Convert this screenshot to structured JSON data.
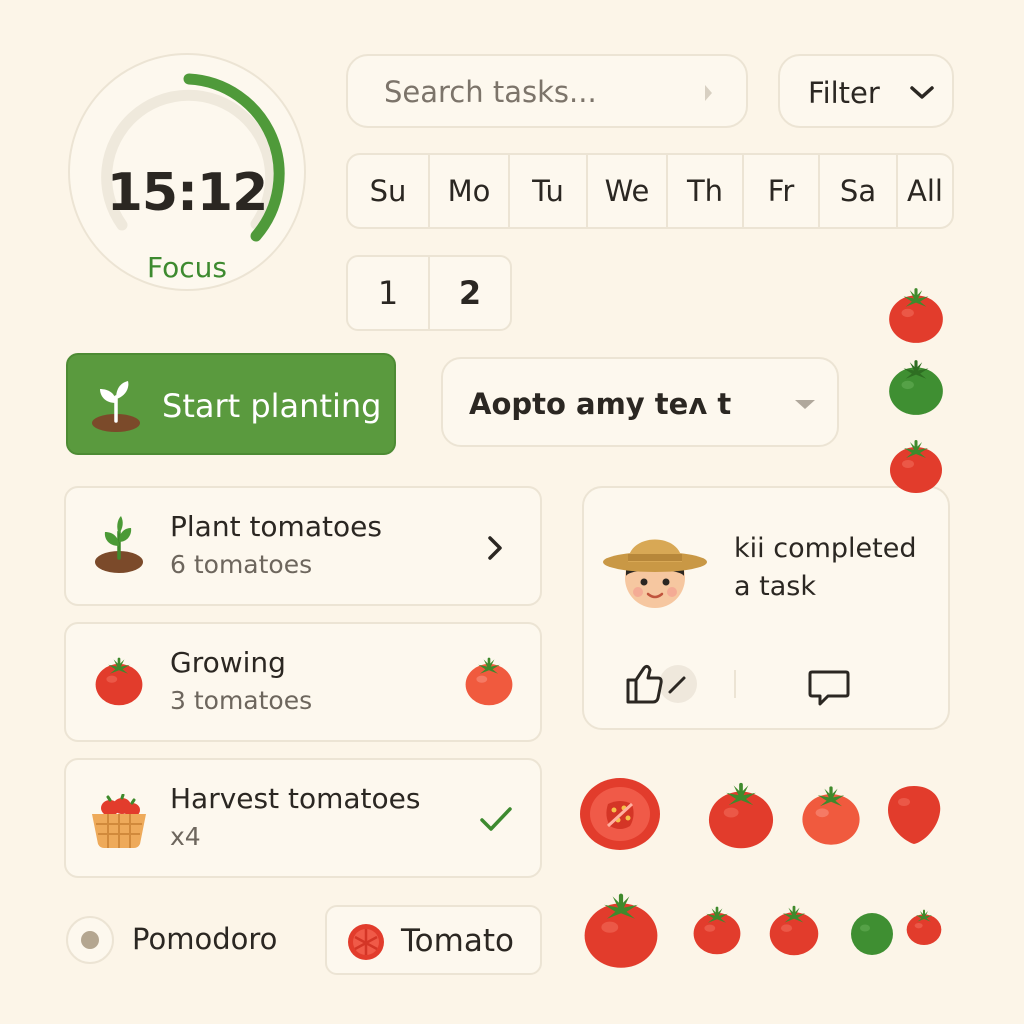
{
  "timer": {
    "time": "15:12",
    "label": "Focus",
    "progress": 0.38
  },
  "search": {
    "placeholder": "Search tasks..."
  },
  "filter": {
    "label": "Filter"
  },
  "days": [
    "Su",
    "Mo",
    "Tu",
    "We",
    "Th",
    "Fr",
    "Sa",
    "All"
  ],
  "pagination": {
    "pages": [
      "1",
      "2"
    ],
    "active": "2"
  },
  "start_button": {
    "label": "Start planting"
  },
  "select": {
    "value": "Aopto amy teʌ t"
  },
  "tasks": [
    {
      "title": "Plant tomatoes",
      "subtitle": "6 tomatoes",
      "trailing_icon": "chevron-right-icon"
    },
    {
      "title": "Growing",
      "subtitle": "3 tomatoes",
      "trailing_icon": "tomato-icon"
    },
    {
      "title": "Harvest tomatoes",
      "subtitle": "x4",
      "trailing_icon": "checkmark-icon"
    }
  ],
  "activity": {
    "message": "kii completed a task"
  },
  "radio": {
    "label": "Pomodoro"
  },
  "chip": {
    "label": "Tomato"
  },
  "colors": {
    "background": "#fcf5e8",
    "accent_green": "#5a9a3e",
    "focus_green": "#3d8a2f",
    "tomato_red": "#e0392b",
    "card_border": "#ece4d4"
  }
}
